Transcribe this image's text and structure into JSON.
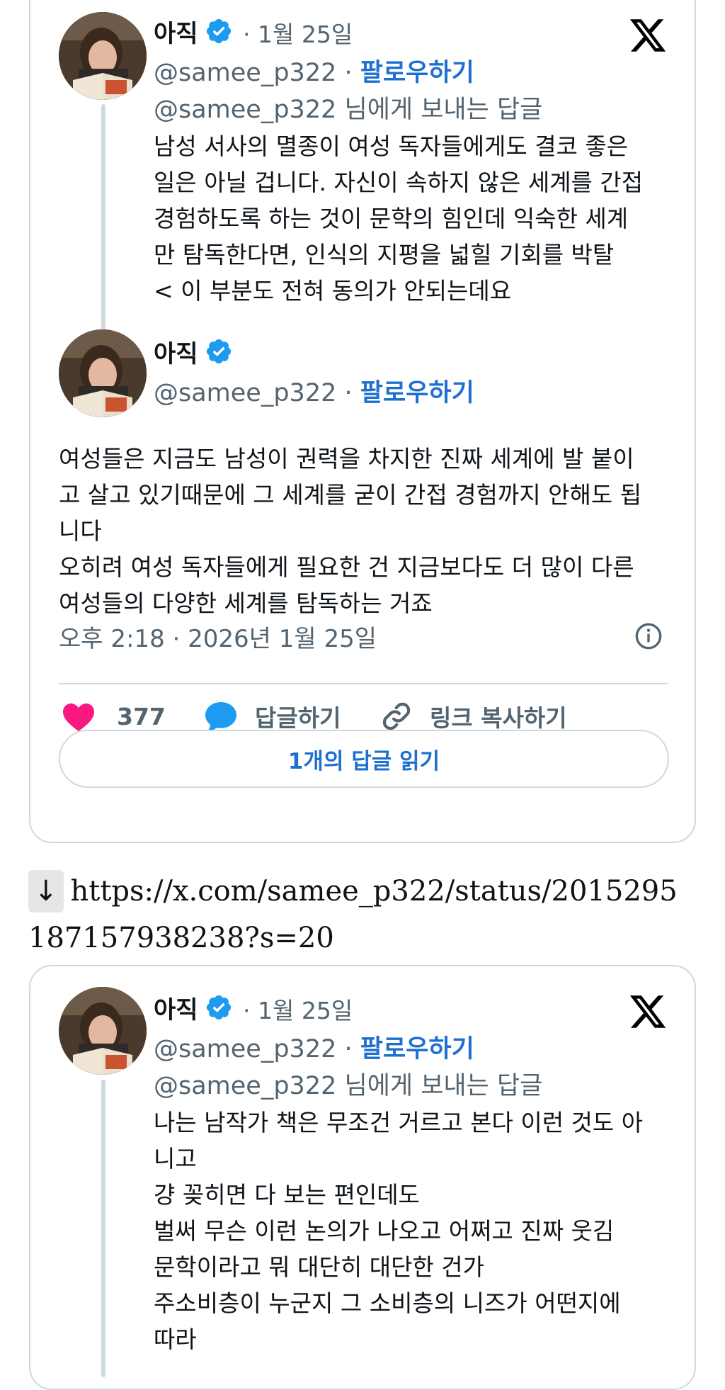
{
  "tweet1": {
    "author_name": "아직",
    "date": "· 1월 25일",
    "handle": "@samee_p322",
    "follow_label": "팔로우하기",
    "separator": " · ",
    "reply_to": "@samee_p322 님에게 보내는 답글",
    "parent_text": "남성 서사의 멸종이 여성 독자들에게도 결코 좋은\n일은 아닐 겁니다. 자신이 속하지 않은 세계를 간접\n경험하도록 하는 것이 문학의 힘인데 익숙한 세계\n만 탐독한다면, 인식의 지평을 넓힐 기회를 박탈\n< 이 부분도 전혀 동의가 안되는데요",
    "main_author_name": "아직",
    "main_handle": "@samee_p322",
    "main_text": "여성들은 지금도 남성이 권력을 차지한 진짜 세계에 발 붙이\n고 살고 있기때문에 그 세계를 굳이 간접 경험까지 안해도 됩\n니다\n오히려 여성 독자들에게 필요한 건 지금보다도 더 많이 다른\n여성들의 다양한 세계를 탐독하는 거죠",
    "timestamp": "오후 2:18 · 2026년 1월 25일",
    "like_count": "377",
    "reply_label": "답글하기",
    "copy_link_label": "링크 복사하기",
    "read_replies_label": "1개의 답글 읽기"
  },
  "link": {
    "arrow": "↓",
    "line1": "https://x.com/samee_p322/status/2015295",
    "line2": "187157938238?s=20"
  },
  "tweet2": {
    "author_name": "아직",
    "date": "· 1월 25일",
    "handle": "@samee_p322",
    "follow_label": "팔로우하기",
    "separator": " · ",
    "reply_to": "@samee_p322 님에게 보내는 답글",
    "text": "나는 남작가 책은 무조건 거르고 본다 이런 것도 아\n니고\n걍 꽂히면 다 보는 편인데도\n벌써 무슨 이런 논의가 나오고 어쩌고 진짜 웃김\n문학이라고 뭐 대단히 대단한 건가\n주소비층이 누군지 그 소비층의 니즈가 어떤지에\n따라"
  },
  "colors": {
    "accent": "#1d6fd0",
    "verified": "#1d9bf0",
    "like": "#f91880",
    "reply": "#1d9bf0",
    "muted": "#536471",
    "border": "#cfd9de"
  },
  "icons": [
    "verified-badge-icon",
    "x-logo-icon",
    "info-icon",
    "heart-icon",
    "speech-bubble-icon",
    "link-icon"
  ]
}
